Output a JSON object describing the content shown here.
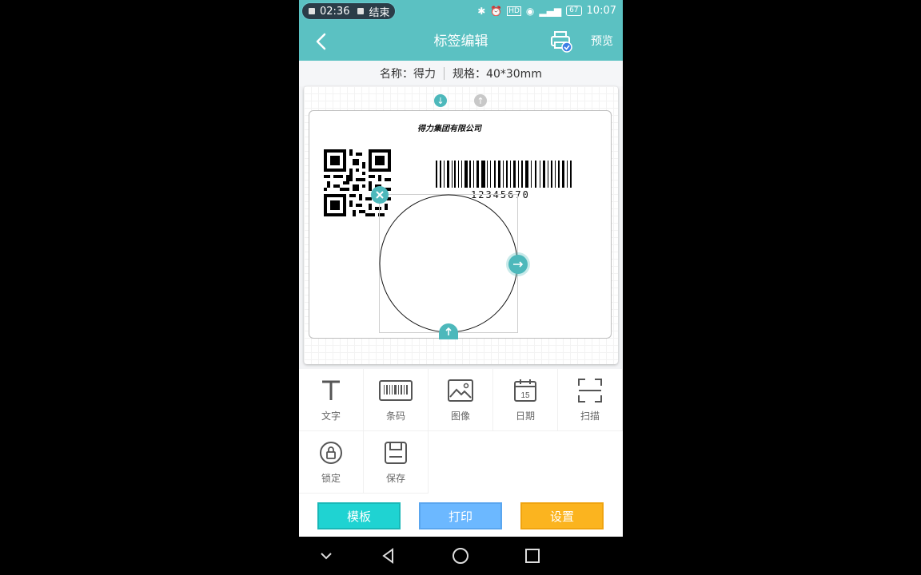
{
  "status": {
    "record_time": "02:36",
    "record_end": "结束",
    "battery": "67",
    "clock": "10:07"
  },
  "appbar": {
    "title": "标签编辑",
    "preview": "预览"
  },
  "info": {
    "name": "名称：得力",
    "spec": "规格：40*30mm"
  },
  "label": {
    "company": "得力集团有限公司",
    "barcode_number": "12345670"
  },
  "tools": [
    {
      "label": "文字",
      "icon": "text-icon"
    },
    {
      "label": "条码",
      "icon": "barcode-icon"
    },
    {
      "label": "图像",
      "icon": "image-icon"
    },
    {
      "label": "日期",
      "icon": "calendar-icon"
    },
    {
      "label": "扫描",
      "icon": "scan-icon"
    },
    {
      "label": "锁定",
      "icon": "lock-icon"
    },
    {
      "label": "保存",
      "icon": "save-icon"
    }
  ],
  "calendar_day": "15",
  "bottom": {
    "template": "模板",
    "print": "打印",
    "settings": "设置"
  },
  "colors": {
    "primary": "#5bc1c2",
    "template_btn": "#1fd3d2",
    "print_btn": "#6cb8ff",
    "settings_btn": "#fbb41f"
  }
}
